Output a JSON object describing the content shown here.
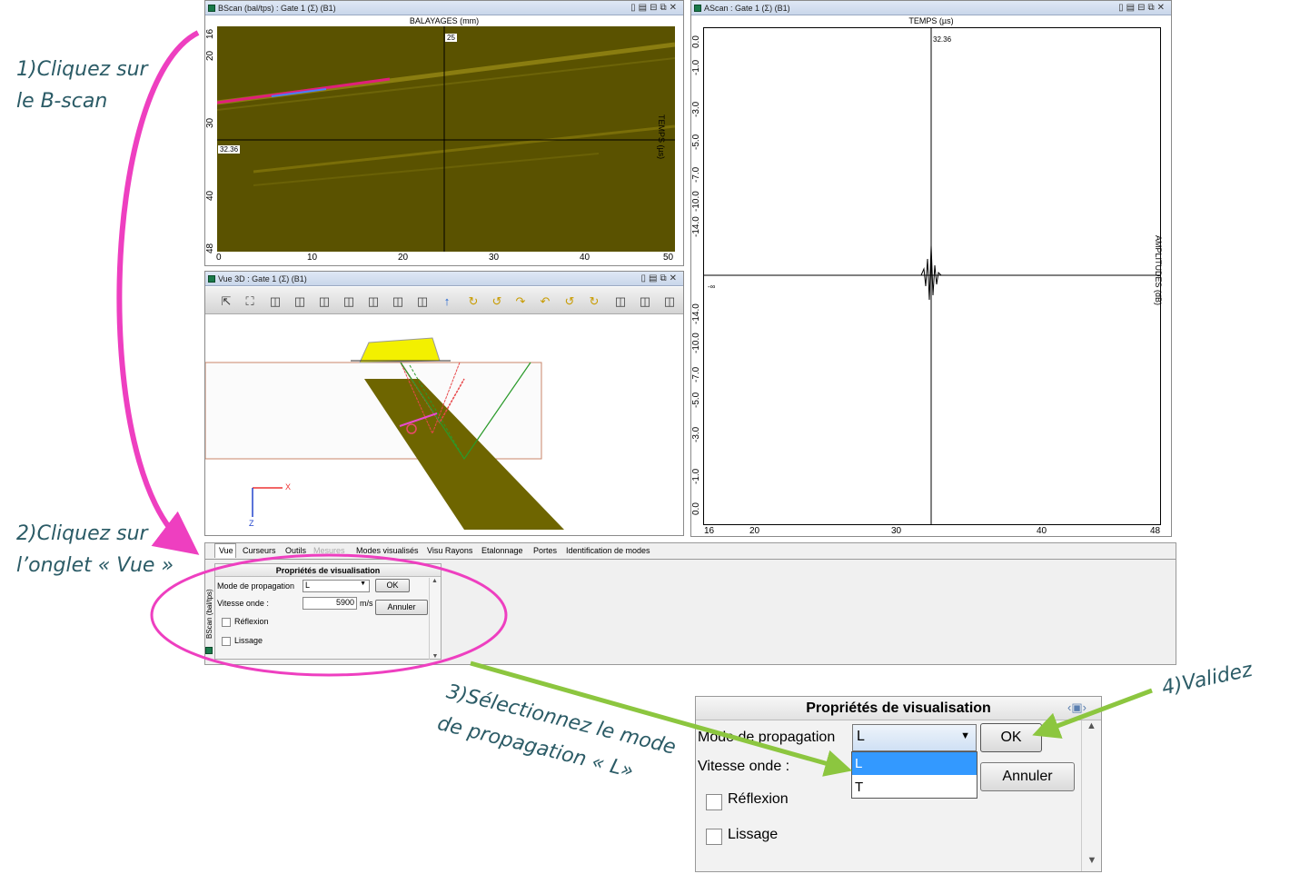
{
  "annotations": {
    "step1_line1": "1)Cliquez sur",
    "step1_line2": "le B-scan",
    "step2_line1": "2)Cliquez sur",
    "step2_line2": "l’onglet « Vue »",
    "step3_line1": "3)Sélectionnez le mode",
    "step3_line2": "de propagation « L»",
    "step4": "4)Validez"
  },
  "bscan": {
    "title": "BScan (bal/tps) : Gate 1 (Σ) (B1)",
    "top_axis_label": "BALAYAGES (mm)",
    "right_axis_label": "TEMPS (µs)",
    "cursor_x_label": "25",
    "cursor_y_label": "32.36",
    "x_ticks": [
      "0",
      "10",
      "20",
      "30",
      "40",
      "50"
    ],
    "y_ticks": [
      "16",
      "20",
      "30",
      "40",
      "48"
    ]
  },
  "ascan": {
    "title": "AScan : Gate 1 (Σ) (B1)",
    "top_axis_label": "TEMPS (µs)",
    "right_axis_label": "AMPLITUDES (dB)",
    "cursor_label": "32.36",
    "minus_inf": "-∞",
    "x_ticks": [
      "16",
      "20",
      "30",
      "40",
      "48"
    ],
    "y_ticks_top": [
      "0.0",
      "-1.0",
      "-3.0",
      "-5.0",
      "-7.0",
      "-10.0",
      "-14.0"
    ],
    "y_ticks_bottom": [
      "-14.0",
      "-10.0",
      "-7.0",
      "-5.0",
      "-3.0",
      "-1.0",
      "0.0"
    ]
  },
  "view3d": {
    "title": "Vue 3D : Gate 1 (Σ) (B1)",
    "axis_x": "X",
    "axis_z": "Z"
  },
  "tabs": [
    "Vue",
    "Curseurs",
    "Outils",
    "Mesures",
    "Modes visualisés",
    "Visu Rayons",
    "Etalonnage",
    "Portes",
    "Identification de modes"
  ],
  "props_small": {
    "side_label": "BScan (bal/tps)",
    "header": "Propriétés de visualisation",
    "mode_label": "Mode de propagation",
    "mode_value": "L",
    "speed_label": "Vitesse onde :",
    "speed_value": "5900",
    "speed_unit": "m/s",
    "ok": "OK",
    "cancel": "Annuler",
    "reflexion": "Réflexion",
    "lissage": "Lissage"
  },
  "props_zoom": {
    "header": "Propriétés de visualisation",
    "mode_label": "Mode de propagation",
    "mode_value": "L",
    "options": [
      "L",
      "T"
    ],
    "speed_label": "Vitesse onde :",
    "ok": "OK",
    "cancel": "Annuler",
    "reflexion": "Réflexion",
    "lissage": "Lissage"
  },
  "colors": {
    "annotation_text": "#2b5b66",
    "magenta_arrow": "#ee3fc0",
    "green_arrow": "#8cc63f",
    "bscan_bg": "#5a5200"
  }
}
